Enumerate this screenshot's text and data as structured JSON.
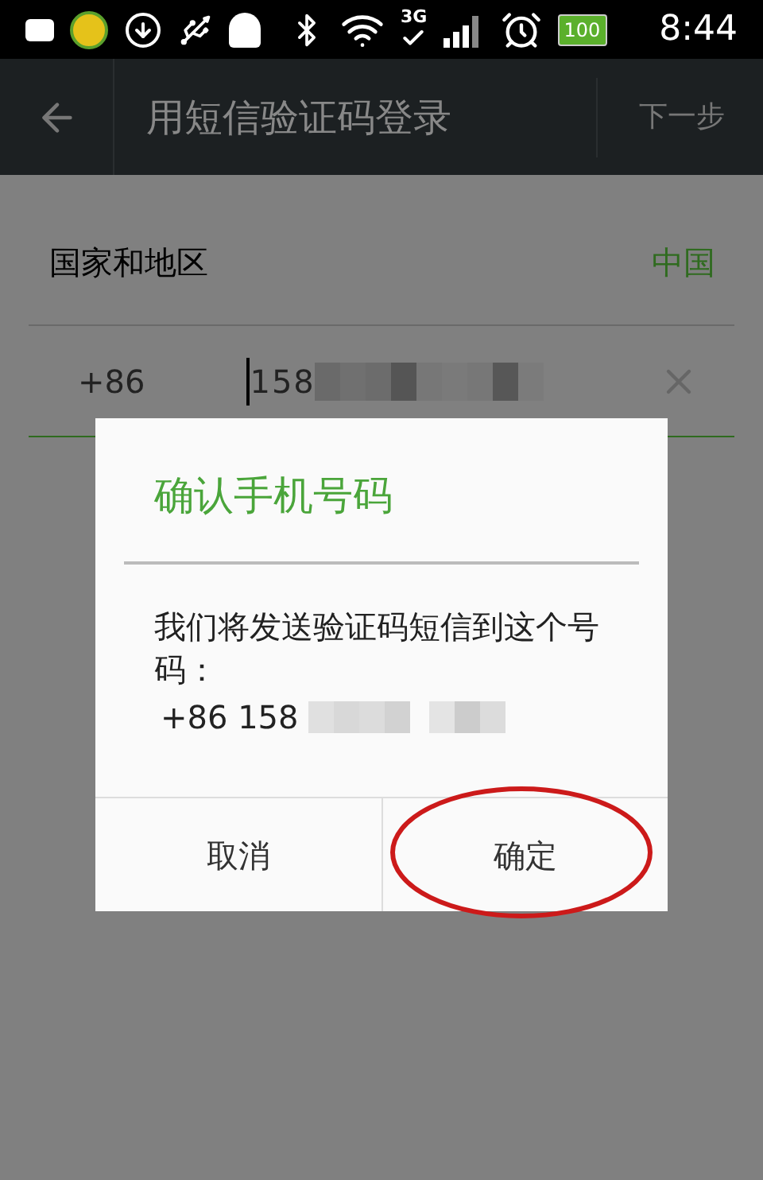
{
  "status_bar": {
    "network": "3G",
    "battery": "100",
    "time": "8:44"
  },
  "app_bar": {
    "title": "用短信验证码登录",
    "action": "下一步"
  },
  "country_row": {
    "label": "国家和地区",
    "value": "中国"
  },
  "phone_field": {
    "code": "+86",
    "value": "158"
  },
  "dialog": {
    "title": "确认手机号码",
    "message": "我们将发送验证码短信到这个号码：",
    "number": "+86 158",
    "buttons": [
      {
        "label": "取消",
        "circled": false
      },
      {
        "label": "确定",
        "circled": true
      }
    ]
  }
}
